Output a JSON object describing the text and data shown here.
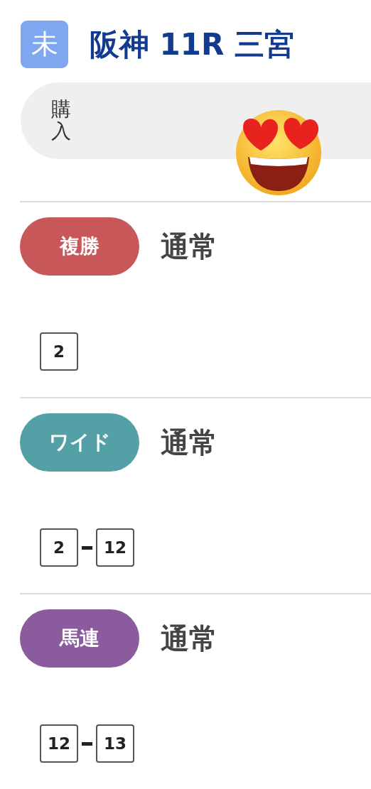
{
  "header": {
    "status_badge": "未",
    "title": "阪神 11R 三宮"
  },
  "purchase_bar": {
    "label": "購入"
  },
  "bets": [
    {
      "type": "複勝",
      "color": "#c8575a",
      "method": "通常",
      "numbers": [
        "2"
      ]
    },
    {
      "type": "ワイド",
      "color": "#53a1a7",
      "method": "通常",
      "numbers": [
        "2",
        "12"
      ]
    },
    {
      "type": "馬連",
      "color": "#8a5b9d",
      "method": "通常",
      "numbers": [
        "12",
        "13"
      ]
    }
  ]
}
